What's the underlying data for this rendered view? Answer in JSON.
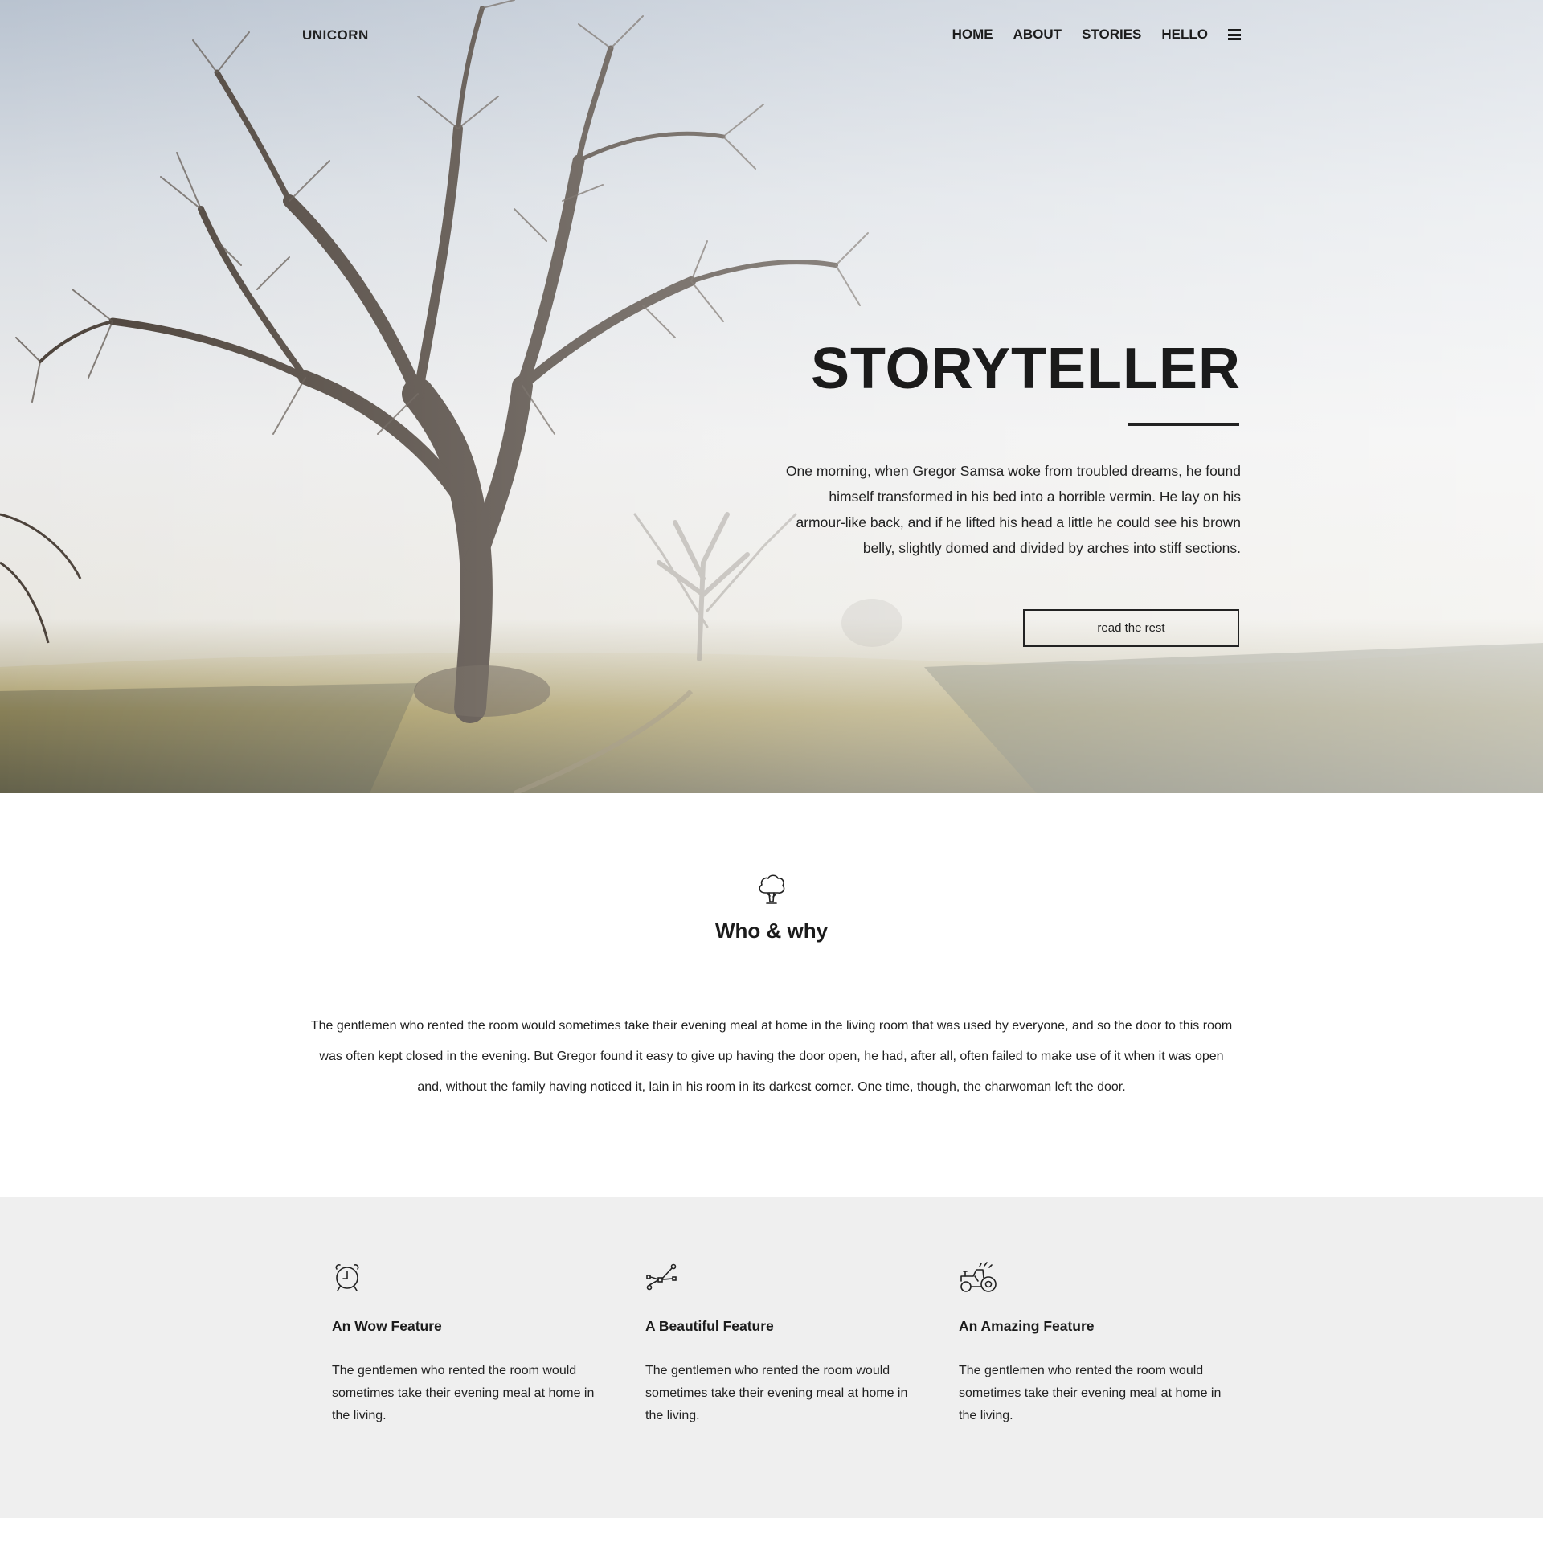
{
  "header": {
    "logo": "UNICORN",
    "nav": [
      "HOME",
      "ABOUT",
      "STORIES",
      "HELLO"
    ]
  },
  "hero": {
    "title": "STORYTELLER",
    "text": "One morning, when Gregor Samsa woke from troubled dreams, he found himself transformed in his bed into a horrible vermin. He lay on his armour-like back, and if he lifted his head a little he could see his brown belly, slightly domed and divided by arches into stiff sections.",
    "button": "read the rest"
  },
  "who": {
    "icon": "tree-icon",
    "title": "Who & why",
    "text": "The gentlemen who rented the room would sometimes take their evening meal at home in the living room that was used by everyone, and so the door to this room was often kept closed in the evening. But Gregor found it easy to give up having the door open, he had, after all, often failed to make use of it when it was open and, without the family having noticed it, lain in his room in its darkest corner. One time, though, the charwoman left the door."
  },
  "features": [
    {
      "icon": "alarm-clock-icon",
      "title": "An Wow Feature",
      "text": "The gentlemen who rented the room would sometimes take their evening meal at home in the living."
    },
    {
      "icon": "vector-path-icon",
      "title": "A Beautiful Feature",
      "text": "The gentlemen who rented the room would sometimes take their evening meal at home in the living."
    },
    {
      "icon": "tractor-icon",
      "title": "An Amazing Feature",
      "text": "The gentlemen who rented the room would sometimes take their evening meal at home in the living."
    }
  ],
  "colors": {
    "text": "#1f1f1f",
    "features_bg": "#efefef",
    "page_bg": "#ffffff"
  }
}
